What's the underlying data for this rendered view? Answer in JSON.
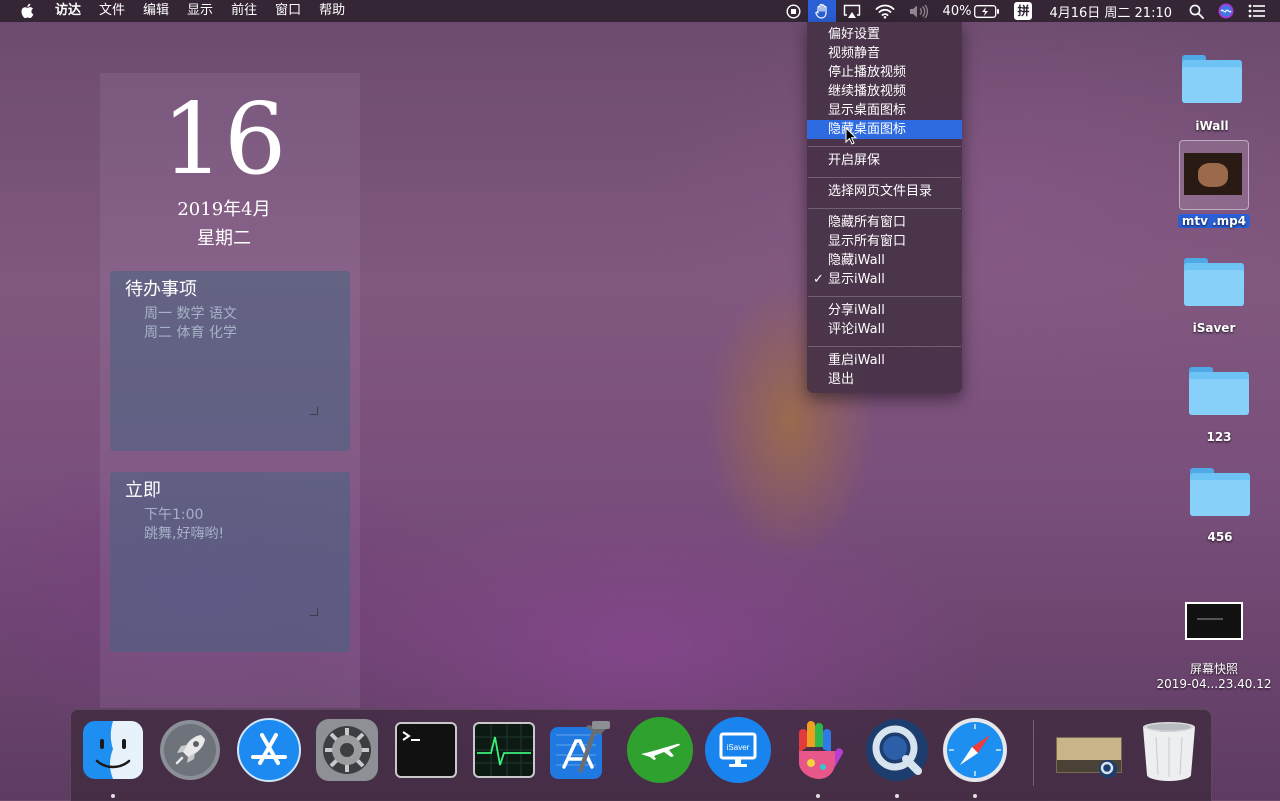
{
  "menubar": {
    "app_menus": [
      "访达",
      "文件",
      "编辑",
      "显示",
      "前往",
      "窗口",
      "帮助"
    ],
    "battery": "40%",
    "input_method": "拼",
    "clock": "4月16日 周二  21:10"
  },
  "iwall_menu": {
    "items": [
      {
        "label": "偏好设置"
      },
      {
        "label": "视频静音"
      },
      {
        "label": "停止播放视频"
      },
      {
        "label": "继续播放视频"
      },
      {
        "label": "显示桌面图标"
      },
      {
        "label": "隐藏桌面图标",
        "highlighted": true
      },
      {
        "label": "开启屏保"
      },
      {
        "label": "选择网页文件目录"
      },
      {
        "label": "隐藏所有窗口"
      },
      {
        "label": "显示所有窗口"
      },
      {
        "label": "隐藏iWall"
      },
      {
        "label": "显示iWall",
        "checked": true
      },
      {
        "label": "分享iWall"
      },
      {
        "label": "评论iWall"
      },
      {
        "label": "重启iWall"
      },
      {
        "label": "退出"
      }
    ],
    "check_mark": "✓"
  },
  "calendar": {
    "day": "16",
    "year_month": "2019年4月",
    "weekday": "星期二"
  },
  "notes": [
    {
      "title": "待办事项",
      "lines": [
        "周一 数学 语文",
        "周二 体育 化学"
      ]
    },
    {
      "title": "立即",
      "lines": [
        "下午1:00",
        "跳舞,好嗨哟!"
      ]
    }
  ],
  "desktop_icons": [
    {
      "label": "iWall",
      "kind": "folder"
    },
    {
      "label": "mtv .mp4",
      "kind": "video",
      "selected": true
    },
    {
      "label": "iSaver",
      "kind": "folder"
    },
    {
      "label": "123",
      "kind": "folder"
    },
    {
      "label": "456",
      "kind": "folder"
    },
    {
      "label_line1": "屏幕快照",
      "label_line2": "2019-04...23.40.12",
      "kind": "screenshot"
    }
  ],
  "dock": {
    "apps": [
      {
        "name": "Finder",
        "icon": "finder-icon",
        "running": true
      },
      {
        "name": "Launchpad",
        "icon": "rocket-icon",
        "running": false
      },
      {
        "name": "App Store",
        "icon": "app-store-icon",
        "running": false
      },
      {
        "name": "System Preferences",
        "icon": "gear-icon",
        "running": false
      },
      {
        "name": "Terminal",
        "icon": "terminal-icon",
        "running": false
      },
      {
        "name": "Activity Monitor",
        "icon": "activity-monitor-icon",
        "running": false
      },
      {
        "name": "Xcode",
        "icon": "xcode-icon",
        "running": false
      },
      {
        "name": "Airplane app",
        "icon": "airplane-icon",
        "running": false
      },
      {
        "name": "iSaver",
        "icon": "isaver-icon",
        "running": false,
        "label": "iSaver"
      },
      {
        "name": "iWall",
        "icon": "hand-icon",
        "running": true
      },
      {
        "name": "QuickTime Player",
        "icon": "quicktime-icon",
        "running": true
      },
      {
        "name": "Safari",
        "icon": "safari-icon",
        "running": true
      }
    ],
    "stack": {
      "name": "Downloads stack",
      "icon": "stack-icon"
    },
    "trash": {
      "name": "Trash",
      "icon": "trash-icon"
    }
  },
  "colors": {
    "highlight": "#2e6ae0",
    "folder": "#6dc3f4",
    "menu_bg": "#46324a"
  }
}
